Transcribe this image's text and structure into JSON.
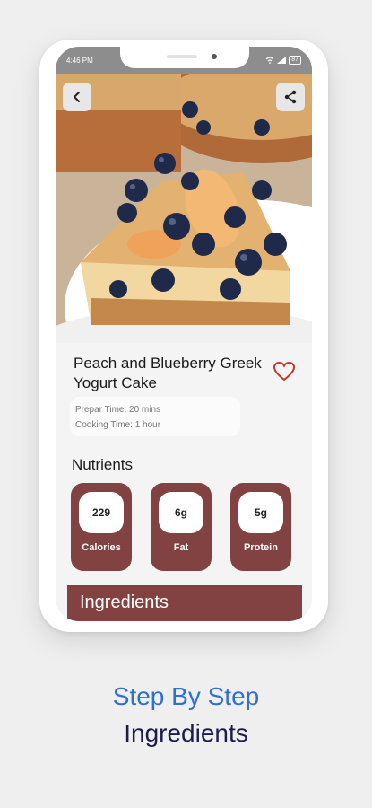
{
  "status": {
    "time": "4:46 PM",
    "battery": "87"
  },
  "recipe": {
    "title": "Peach and Blueberry Greek Yogurt Cake",
    "prep_time": "Prepar Time: 20 mins",
    "cook_time": "Cooking Time: 1 hour"
  },
  "nutrients": {
    "heading": "Nutrients",
    "items": [
      {
        "value": "229",
        "label": "Calories"
      },
      {
        "value": "6g",
        "label": "Fat"
      },
      {
        "value": "5g",
        "label": "Protein"
      }
    ]
  },
  "ingredients_label": "Ingredients",
  "caption": {
    "line1": "Step By Step",
    "line2": "Ingredients"
  },
  "colors": {
    "accent": "#824242",
    "caption_blue": "#2f6fd1",
    "caption_navy": "#1c1c4a",
    "heart": "#c0392b"
  },
  "icons": [
    "back-arrow-icon",
    "share-icon",
    "heart-icon",
    "wifi-icon",
    "signal-icon",
    "battery-icon"
  ]
}
